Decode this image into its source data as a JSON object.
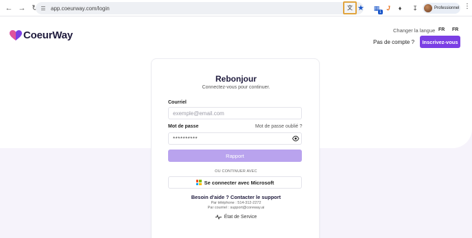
{
  "browser": {
    "url": "app.coeurway.com/login",
    "profile_label": "Professionnel"
  },
  "header": {
    "brand": "CoeurWay",
    "lang_label": "Changer la langue",
    "lang_option_1": "FR",
    "lang_option_2": "FR",
    "no_account_text": "Pas de compte ?",
    "signup_label": "Inscrivez-vous"
  },
  "login": {
    "title": "Rebonjour",
    "subtitle": "Connectez-vous pour continuer.",
    "email_label": "Courriel",
    "email_placeholder": "exemple@email.com",
    "password_label": "Mot de passe",
    "forgot_link": "Mot de passe oublié ?",
    "password_value": "**********",
    "submit_label": "Rapport",
    "or_text": "OU CONTINUER AVEC",
    "microsoft_label": "Se connecter avec Microsoft"
  },
  "support": {
    "title": "Besoin d'aide ? Contacter le support",
    "phone": "Par téléphone : 514-312-2272",
    "email": "Par courriel : support@coreway.ai",
    "status_label": "État de Service"
  },
  "colors": {
    "accent": "#7b3fe4",
    "accent_light": "#b9a3ee",
    "brand_dark": "#1e1a3c"
  }
}
